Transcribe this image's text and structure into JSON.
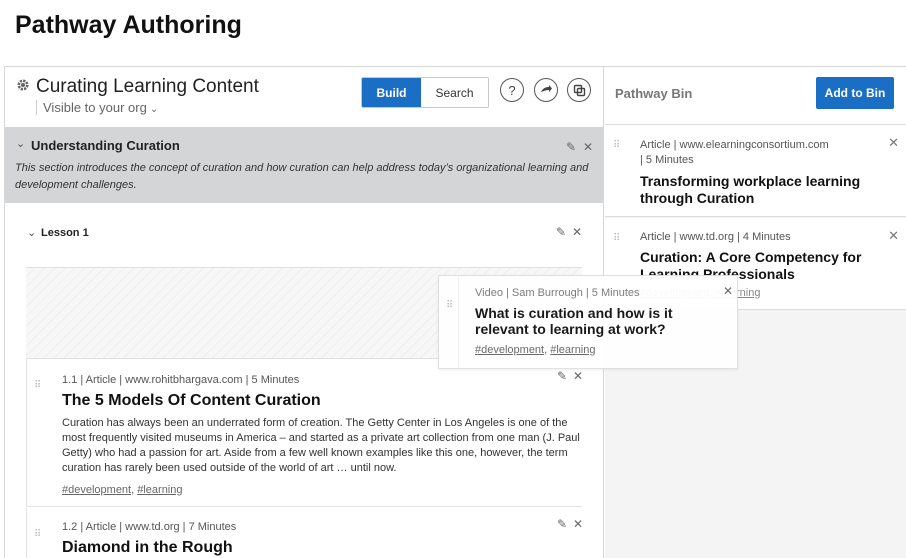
{
  "page": {
    "title": "Pathway Authoring"
  },
  "pathway": {
    "title": "Curating Learning Content",
    "visibility": "Visible to your org",
    "mode_build": "Build",
    "mode_search": "Search",
    "help_icon": "?",
    "share_icon": "→",
    "copy_icon": "⧉"
  },
  "section": {
    "title": "Understanding Curation",
    "description": "This section introduces the concept of curation and how curation can help address today’s organizational learning and development challenges."
  },
  "lesson": {
    "label": "Lesson 1"
  },
  "items": [
    {
      "meta": "1.1 | Article  | www.rohitbhargava.com | 5 Minutes",
      "title": "The 5 Models Of Content Curation",
      "description": "Curation has always been an underrated form of creation. The Getty Center in Los Angeles is one of the most frequently visited museums in America – and started as a private art collection from one man (J. Paul Getty) who had a passion for art. Aside from a few well known examples like this one, however, the term curation has rarely been used outside of the world of art … until now.",
      "tags": [
        "#development",
        "#learning"
      ]
    },
    {
      "meta": "1.2 | Article  | www.td.org  | 7 Minutes",
      "title": "Diamond in the Rough"
    }
  ],
  "bin": {
    "title": "Pathway Bin",
    "add_label": "Add to Bin",
    "cards": [
      {
        "meta_line1": "Article | www.elearningconsortium.com",
        "meta_line2": "| 5 Minutes",
        "title": "Transforming workplace learning through Curation"
      },
      {
        "meta_line1": "Article | www.td.org  | 4 Minutes",
        "title": "Curation: A Core Competency for Learning Professionals",
        "tags_visible": "#development, #learning"
      }
    ]
  },
  "drag": {
    "meta": "Video | Sam Burrough  | 5 Minutes",
    "title": "What is curation and how is it relevant to learning at work?",
    "tags": [
      "#development",
      "#learning"
    ]
  },
  "icons": {
    "gear": "gear-icon",
    "edit": "✎",
    "close": "✕",
    "grip": "⋮⋮",
    "chevron": "⌄"
  },
  "colors": {
    "accent": "#1a6fc4",
    "section_bg": "#d3d5d7",
    "bin_bg": "#f4f4f4"
  }
}
